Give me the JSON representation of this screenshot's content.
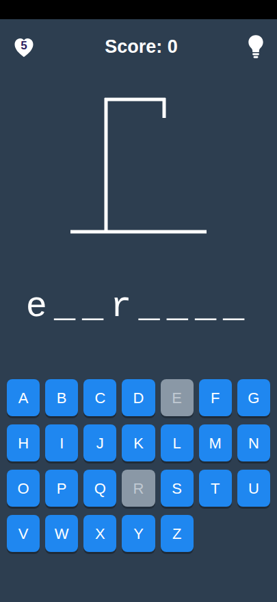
{
  "status": {
    "lives": "5",
    "score": "Score: 0"
  },
  "hangman": {
    "wrong_guesses": 0
  },
  "word": "e__r____",
  "keyboard": [
    [
      {
        "label": "A",
        "disabled": false
      },
      {
        "label": "B",
        "disabled": false
      },
      {
        "label": "C",
        "disabled": false
      },
      {
        "label": "D",
        "disabled": false
      },
      {
        "label": "E",
        "disabled": true
      },
      {
        "label": "F",
        "disabled": false
      },
      {
        "label": "G",
        "disabled": false
      }
    ],
    [
      {
        "label": "H",
        "disabled": false
      },
      {
        "label": "I",
        "disabled": false
      },
      {
        "label": "J",
        "disabled": false
      },
      {
        "label": "K",
        "disabled": false
      },
      {
        "label": "L",
        "disabled": false
      },
      {
        "label": "M",
        "disabled": false
      },
      {
        "label": "N",
        "disabled": false
      }
    ],
    [
      {
        "label": "O",
        "disabled": false
      },
      {
        "label": "P",
        "disabled": false
      },
      {
        "label": "Q",
        "disabled": false
      },
      {
        "label": "R",
        "disabled": true
      },
      {
        "label": "S",
        "disabled": false
      },
      {
        "label": "T",
        "disabled": false
      },
      {
        "label": "U",
        "disabled": false
      }
    ],
    [
      {
        "label": "V",
        "disabled": false
      },
      {
        "label": "W",
        "disabled": false
      },
      {
        "label": "X",
        "disabled": false
      },
      {
        "label": "Y",
        "disabled": false
      },
      {
        "label": "Z",
        "disabled": false
      }
    ]
  ]
}
